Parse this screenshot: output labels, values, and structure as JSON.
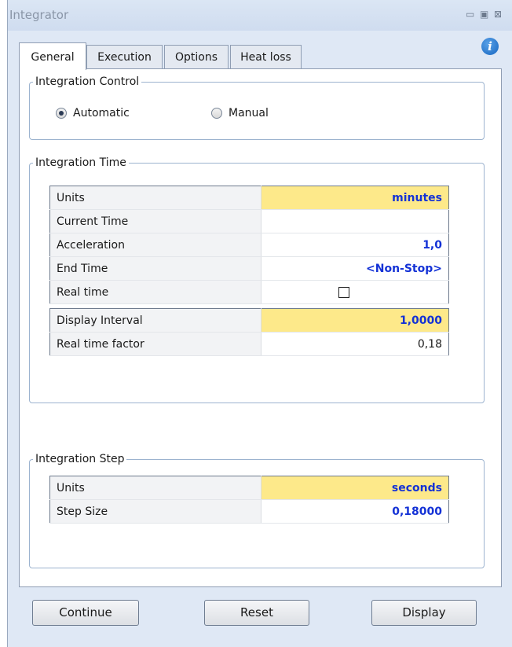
{
  "window": {
    "title": "Integrator",
    "minimize_glyph": "▭",
    "restore_glyph": "▣",
    "close_glyph": "⊠"
  },
  "info_icon": "i",
  "tabs": [
    {
      "label": "General",
      "active": true
    },
    {
      "label": "Execution",
      "active": false
    },
    {
      "label": "Options",
      "active": false
    },
    {
      "label": "Heat loss",
      "active": false
    }
  ],
  "integration_control": {
    "legend": "Integration Control",
    "options": [
      {
        "label": "Automatic",
        "checked": true
      },
      {
        "label": "Manual",
        "checked": false
      }
    ]
  },
  "integration_time": {
    "legend": "Integration Time",
    "rows": [
      {
        "label": "Units",
        "value": "minutes"
      },
      {
        "label": "Current Time",
        "value": ""
      },
      {
        "label": "Acceleration",
        "value": "1,0"
      },
      {
        "label": "End Time",
        "value": "<Non-Stop>"
      },
      {
        "label": "Real time",
        "value": "",
        "checkbox_checked": false
      }
    ],
    "rows2": [
      {
        "label": "Display Interval",
        "value": "1,0000"
      },
      {
        "label": "Real time factor",
        "value": "0,18"
      }
    ]
  },
  "integration_step": {
    "legend": "Integration Step",
    "rows": [
      {
        "label": "Units",
        "value": "seconds"
      },
      {
        "label": "Step Size",
        "value": "0,18000"
      }
    ]
  },
  "buttons": {
    "continue": "Continue",
    "reset": "Reset",
    "display": "Display"
  },
  "colors": {
    "highlight": "#fde98a",
    "value_blue": "#1432d6",
    "window_bg": "#dfe8f5"
  }
}
